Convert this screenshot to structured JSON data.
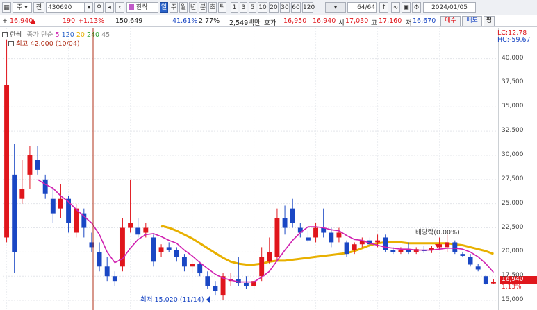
{
  "toolbar": {
    "mode_select": "주",
    "filter_label": "전",
    "code": "430690",
    "stock_name": "한싹",
    "periods": [
      "일",
      "주",
      "월",
      "년",
      "분",
      "초",
      "틱"
    ],
    "intervals": [
      "1",
      "3",
      "5",
      "10",
      "20",
      "30",
      "60",
      "120"
    ],
    "count": "64",
    "count_total": "/64",
    "date": "2024/01/05"
  },
  "quote": {
    "price": "16,940",
    "change_arrow": "▲",
    "change": "190",
    "change_pct": "+1.13%",
    "volume": "150,649",
    "volume_ratio": "41.61%",
    "turnover": "2.77%",
    "amount": "2,549백만",
    "ask_label": "호가",
    "ask": "16,950",
    "bid": "16,940",
    "open_label": "시",
    "open": "17,030",
    "high_label": "고",
    "high": "17,160",
    "low_label": "저",
    "low": "16,670",
    "buy_label": "매수",
    "sell_label": "매도",
    "eval_label": "평"
  },
  "legend": {
    "name": "한싹",
    "ma_label": "종가 단순",
    "ma5": "5",
    "ma120": "120",
    "ma20": "20",
    "ma240": "240",
    "ma45": "45",
    "high_label": "최고 42,000 (10/04)",
    "lc": "LC:12.78",
    "hc": "HC:-59.67"
  },
  "annotations": {
    "low_label": "최저 15,020 (11/14)",
    "dividend": "배당락(0.00%)",
    "last_price": "16,940",
    "last_pct": "1.13%"
  },
  "colors": {
    "up": "#e0161c",
    "down": "#1a47c4",
    "ma5": "#d020b0",
    "ma20": "#e8b000"
  },
  "chart_data": {
    "type": "candlestick",
    "ylim": [
      14000,
      43200
    ],
    "yticks": [
      15000,
      17500,
      20000,
      22500,
      25000,
      27500,
      30000,
      32500,
      35000,
      37500,
      40000
    ],
    "candles": [
      {
        "o": 21500,
        "h": 42000,
        "l": 21000,
        "c": 37300
      },
      {
        "o": 28000,
        "h": 31200,
        "l": 17800,
        "c": 20000
      },
      {
        "o": 25500,
        "h": 29500,
        "l": 25000,
        "c": 26500
      },
      {
        "o": 28000,
        "h": 31000,
        "l": 26500,
        "c": 30000
      },
      {
        "o": 29500,
        "h": 31000,
        "l": 28000,
        "c": 28500
      },
      {
        "o": 27500,
        "h": 28000,
        "l": 25500,
        "c": 26000
      },
      {
        "o": 25500,
        "h": 26500,
        "l": 23000,
        "c": 24000
      },
      {
        "o": 24500,
        "h": 27000,
        "l": 23500,
        "c": 25500
      },
      {
        "o": 25500,
        "h": 25800,
        "l": 22000,
        "c": 23000
      },
      {
        "o": 22000,
        "h": 25000,
        "l": 21500,
        "c": 24500
      },
      {
        "o": 24000,
        "h": 24500,
        "l": 21500,
        "c": 22500
      },
      {
        "o": 21000,
        "h": 22000,
        "l": 20000,
        "c": 20500
      },
      {
        "o": 20000,
        "h": 21000,
        "l": 18000,
        "c": 18500
      },
      {
        "o": 18500,
        "h": 19500,
        "l": 17000,
        "c": 17500
      },
      {
        "o": 17500,
        "h": 18000,
        "l": 16500,
        "c": 17000
      },
      {
        "o": 18500,
        "h": 23500,
        "l": 18000,
        "c": 22500
      },
      {
        "o": 22500,
        "h": 27500,
        "l": 22000,
        "c": 23000
      },
      {
        "o": 22500,
        "h": 23500,
        "l": 21500,
        "c": 21800
      },
      {
        "o": 22000,
        "h": 23000,
        "l": 21500,
        "c": 22500
      },
      {
        "o": 21500,
        "h": 21800,
        "l": 18500,
        "c": 19000
      },
      {
        "o": 20000,
        "h": 20800,
        "l": 19500,
        "c": 20500
      },
      {
        "o": 20500,
        "h": 21000,
        "l": 20000,
        "c": 20200
      },
      {
        "o": 20200,
        "h": 20500,
        "l": 19000,
        "c": 19500
      },
      {
        "o": 19500,
        "h": 19800,
        "l": 18000,
        "c": 18500
      },
      {
        "o": 18500,
        "h": 19200,
        "l": 17800,
        "c": 18800
      },
      {
        "o": 18800,
        "h": 19000,
        "l": 17500,
        "c": 17800
      },
      {
        "o": 17500,
        "h": 18000,
        "l": 16200,
        "c": 16500
      },
      {
        "o": 16500,
        "h": 17000,
        "l": 15500,
        "c": 16000
      },
      {
        "o": 15500,
        "h": 17800,
        "l": 15020,
        "c": 17500
      },
      {
        "o": 17000,
        "h": 17800,
        "l": 16500,
        "c": 17200
      },
      {
        "o": 17200,
        "h": 19500,
        "l": 16500,
        "c": 16800
      },
      {
        "o": 16800,
        "h": 17500,
        "l": 16200,
        "c": 16500
      },
      {
        "o": 16500,
        "h": 17200,
        "l": 16200,
        "c": 17000
      },
      {
        "o": 17500,
        "h": 20500,
        "l": 17000,
        "c": 19500
      },
      {
        "o": 19000,
        "h": 21500,
        "l": 18800,
        "c": 20000
      },
      {
        "o": 19500,
        "h": 24500,
        "l": 19000,
        "c": 23500
      },
      {
        "o": 23500,
        "h": 24800,
        "l": 21800,
        "c": 22500
      },
      {
        "o": 24500,
        "h": 25500,
        "l": 22500,
        "c": 23000
      },
      {
        "o": 22500,
        "h": 23000,
        "l": 21500,
        "c": 22000
      },
      {
        "o": 21500,
        "h": 22200,
        "l": 21000,
        "c": 21200
      },
      {
        "o": 21500,
        "h": 23000,
        "l": 21000,
        "c": 22500
      },
      {
        "o": 22500,
        "h": 24500,
        "l": 21500,
        "c": 22000
      },
      {
        "o": 22000,
        "h": 22500,
        "l": 20500,
        "c": 21000
      },
      {
        "o": 21500,
        "h": 22500,
        "l": 21000,
        "c": 22000
      },
      {
        "o": 21000,
        "h": 21200,
        "l": 19500,
        "c": 19800
      },
      {
        "o": 20200,
        "h": 21000,
        "l": 19800,
        "c": 20800
      },
      {
        "o": 20800,
        "h": 21500,
        "l": 20500,
        "c": 21200
      },
      {
        "o": 21200,
        "h": 21500,
        "l": 20500,
        "c": 20800
      },
      {
        "o": 21000,
        "h": 21800,
        "l": 20500,
        "c": 21200
      },
      {
        "o": 21500,
        "h": 21800,
        "l": 20000,
        "c": 20200
      },
      {
        "o": 20200,
        "h": 20500,
        "l": 19800,
        "c": 20000
      },
      {
        "o": 20000,
        "h": 20500,
        "l": 19800,
        "c": 20200
      },
      {
        "o": 20200,
        "h": 21000,
        "l": 19800,
        "c": 20000
      },
      {
        "o": 20000,
        "h": 20500,
        "l": 19800,
        "c": 20300
      },
      {
        "o": 20200,
        "h": 20600,
        "l": 19900,
        "c": 20100
      },
      {
        "o": 20200,
        "h": 20600,
        "l": 19900,
        "c": 20400
      },
      {
        "o": 20500,
        "h": 21500,
        "l": 20300,
        "c": 20800
      },
      {
        "o": 20500,
        "h": 21800,
        "l": 20000,
        "c": 21000
      },
      {
        "o": 21000,
        "h": 21200,
        "l": 19800,
        "c": 20000
      },
      {
        "o": 19800,
        "h": 20000,
        "l": 19500,
        "c": 19600
      },
      {
        "o": 19500,
        "h": 19800,
        "l": 18500,
        "c": 18700
      },
      {
        "o": 18500,
        "h": 18800,
        "l": 18000,
        "c": 18200
      },
      {
        "o": 17500,
        "h": 17600,
        "l": 16600,
        "c": 16700
      },
      {
        "o": 16750,
        "h": 17160,
        "l": 16670,
        "c": 16940
      }
    ],
    "ma5": [
      null,
      null,
      null,
      null,
      27500,
      27000,
      26600,
      25800,
      25200,
      24400,
      23700,
      23000,
      21800,
      20000,
      18900,
      19300,
      20400,
      21300,
      21800,
      21900,
      21600,
      21200,
      20900,
      20200,
      19600,
      18900,
      18300,
      17700,
      17300,
      17100,
      16900,
      16900,
      16900,
      17400,
      18000,
      19100,
      20200,
      21200,
      22000,
      22600,
      22600,
      22500,
      22300,
      22200,
      21700,
      21300,
      21200,
      20900,
      20700,
      20500,
      20400,
      20300,
      20300,
      20200,
      20200,
      20200,
      20300,
      20400,
      20400,
      20300,
      20000,
      19500,
      18800,
      17900
    ],
    "ma20": [
      null,
      null,
      null,
      null,
      null,
      null,
      null,
      null,
      null,
      null,
      null,
      null,
      null,
      null,
      null,
      null,
      null,
      null,
      null,
      null,
      22700,
      22500,
      22200,
      21800,
      21400,
      20900,
      20400,
      19900,
      19400,
      19000,
      18800,
      18700,
      18700,
      18800,
      19000,
      19100,
      19100,
      19200,
      19300,
      19400,
      19500,
      19600,
      19700,
      19800,
      19900,
      20100,
      20400,
      20700,
      20900,
      21000,
      21000,
      21000,
      20900,
      20900,
      20900,
      20900,
      20900,
      20900,
      20800,
      20700,
      20500,
      20300,
      20100,
      19800
    ]
  }
}
